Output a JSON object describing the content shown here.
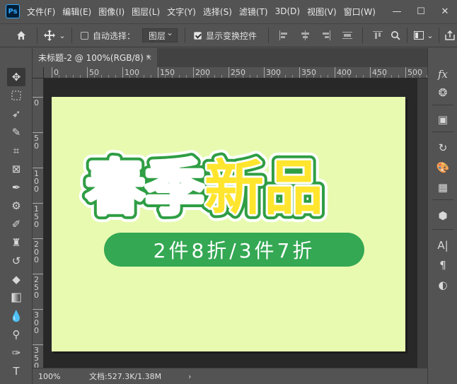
{
  "app": {
    "logo": "Ps"
  },
  "menu": [
    "文件(F)",
    "编辑(E)",
    "图像(I)",
    "图层(L)",
    "文字(Y)",
    "选择(S)",
    "滤镜(T)",
    "3D(D)",
    "视图(V)",
    "窗口(W)"
  ],
  "window_controls": {
    "minimize": "—",
    "maximize": "☐",
    "close": "✕"
  },
  "options": {
    "auto_select_label": "自动选择：",
    "auto_select_checked": false,
    "target_value": "图层",
    "show_transform_label": "显示变换控件",
    "show_transform_checked": true
  },
  "document": {
    "tab_title": "未标题-2 @ 100%(RGB/8) *",
    "tab_close": "×",
    "canvas_color": "#e8fab0"
  },
  "ruler": {
    "top_labels": [
      "0",
      "50",
      "100",
      "150",
      "200",
      "250",
      "300",
      "350",
      "400",
      "450",
      "500"
    ],
    "left_labels": [
      "0",
      "5\n0",
      "1\n0\n0",
      "1\n5\n0",
      "2\n0\n0",
      "2\n5\n0",
      "3\n0\n0",
      "3\n5\n0"
    ]
  },
  "artwork": {
    "headline_white": "春季",
    "headline_yellow": "新品",
    "subline": "2件8折/3件7折",
    "colors": {
      "green": "#34a853",
      "yellow": "#ffe52e",
      "outline": "#2f9e44",
      "white": "#ffffff"
    }
  },
  "status": {
    "zoom": "100%",
    "doc_size": "文档:527.3K/1.38M",
    "arrow": "›"
  }
}
